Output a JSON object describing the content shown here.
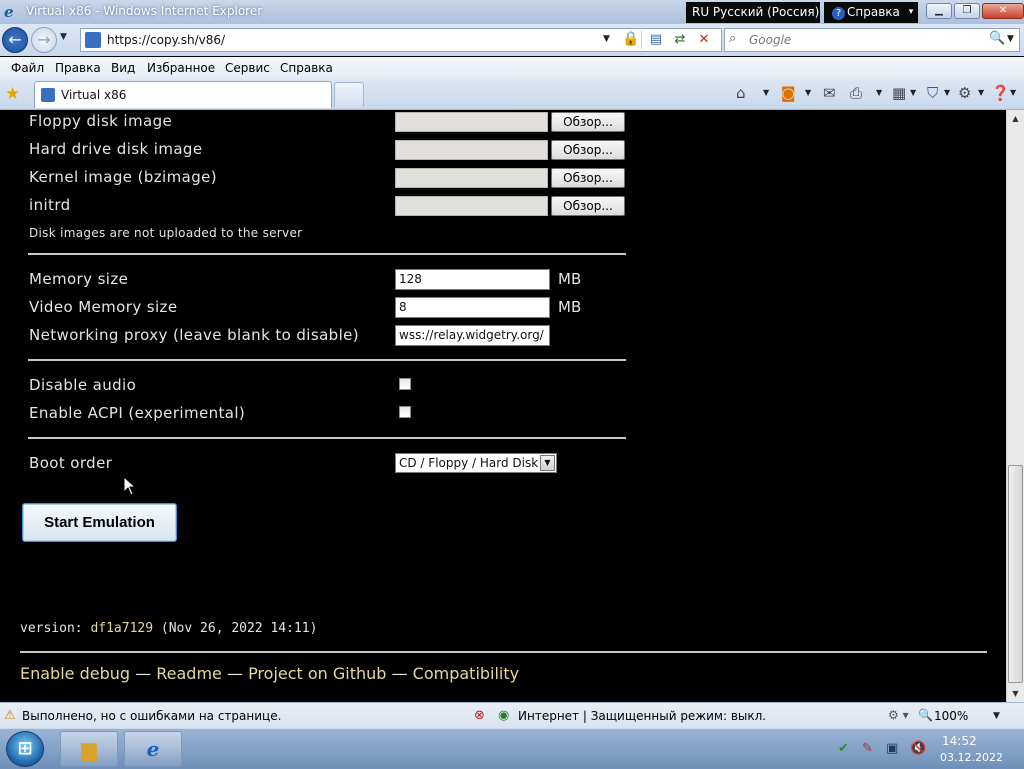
{
  "window": {
    "title": "Virtual x86 - Windows Internet Explorer",
    "language_bar": "RU Русский (Россия)",
    "help_label": "Справка"
  },
  "address": {
    "url": "https://copy.sh/v86/",
    "search_placeholder": "Google"
  },
  "menu": [
    "Файл",
    "Правка",
    "Вид",
    "Избранное",
    "Сервис",
    "Справка"
  ],
  "tab": {
    "label": "Virtual x86"
  },
  "form": {
    "file_inputs": [
      {
        "label": "Floppy disk image",
        "button": "Обзор..."
      },
      {
        "label": "Hard drive disk image",
        "button": "Обзор..."
      },
      {
        "label": "Kernel image (bzimage)",
        "button": "Обзор..."
      },
      {
        "label": "initrd",
        "button": "Обзор..."
      }
    ],
    "upload_note": "Disk images are not uploaded to the server",
    "memory": {
      "label": "Memory size",
      "value": "128",
      "unit": "MB"
    },
    "video_memory": {
      "label": "Video Memory size",
      "value": "8",
      "unit": "MB"
    },
    "proxy": {
      "label": "Networking proxy (leave blank to disable)",
      "value": "wss://relay.widgetry.org/"
    },
    "disable_audio": {
      "label": "Disable audio",
      "checked": false
    },
    "enable_acpi": {
      "label": "Enable ACPI (experimental)",
      "checked": false
    },
    "boot_order": {
      "label": "Boot order",
      "selected": "CD / Floppy / Hard Disk"
    },
    "start_button": "Start Emulation"
  },
  "footer": {
    "version_prefix": "version: ",
    "version_hash": "df1a7129",
    "version_date": " (Nov 26, 2022 14:11)",
    "links": [
      "Enable debug",
      "Readme",
      "Project on Github",
      "Compatibility"
    ],
    "separator": "—"
  },
  "status": {
    "message": "Выполнено, но с ошибками на странице.",
    "zone": "Интернет | Защищенный режим: выкл.",
    "zoom": "100%"
  },
  "taskbar": {
    "time": "14:52",
    "date": "03.12.2022"
  },
  "colors": {
    "page_background": "#000000",
    "footer_link": "#e8d79a",
    "text": "#e4e4e4",
    "start_button_border": "#3e8ed8"
  },
  "icons": {
    "back": "back-arrow-icon",
    "forward": "forward-arrow-icon",
    "lock": "lock-icon",
    "favorites": "star-icon",
    "home": "home-icon",
    "feeds": "rss-icon",
    "print": "printer-icon",
    "safety": "shield-icon",
    "tools": "gear-icon",
    "help": "help-icon"
  }
}
